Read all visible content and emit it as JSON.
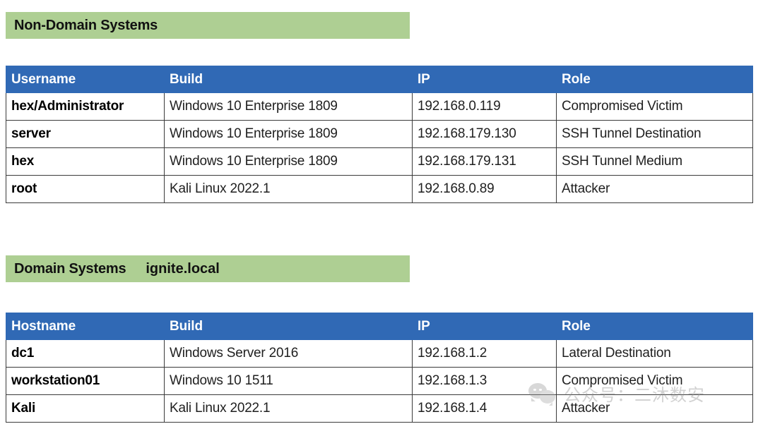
{
  "sections": [
    {
      "banner": {
        "title": "Non-Domain Systems",
        "subtitle": ""
      },
      "table": {
        "headers": [
          "Username",
          "Build",
          "IP",
          "Role"
        ],
        "rows": [
          [
            "hex/Administrator",
            "Windows 10 Enterprise 1809",
            "192.168.0.119",
            "Compromised Victim"
          ],
          [
            "server",
            "Windows 10 Enterprise 1809",
            "192.168.179.130",
            "SSH Tunnel Destination"
          ],
          [
            "hex",
            "Windows 10 Enterprise 1809",
            "192.168.179.131",
            "SSH Tunnel Medium"
          ],
          [
            "root",
            "Kali Linux 2022.1",
            "192.168.0.89",
            "Attacker"
          ]
        ]
      }
    },
    {
      "banner": {
        "title": "Domain Systems",
        "subtitle": "ignite.local"
      },
      "table": {
        "headers": [
          "Hostname",
          "Build",
          "IP",
          "Role"
        ],
        "rows": [
          [
            "dc1",
            "Windows Server 2016",
            "192.168.1.2",
            "Lateral Destination"
          ],
          [
            "workstation01",
            "Windows 10 1511",
            "192.168.1.3",
            "Compromised Victim"
          ],
          [
            "Kali",
            "Kali Linux 2022.1",
            "192.168.1.4",
            "Attacker"
          ]
        ]
      }
    }
  ],
  "watermark": {
    "text": "公众号：二沐数安",
    "icon": "wechat-icon"
  },
  "colors": {
    "banner_green": "#AECF93",
    "header_blue": "#3069B5",
    "header_text": "#ffffff",
    "body_text": "#1f1f1f",
    "border": "#3a3a3a"
  }
}
